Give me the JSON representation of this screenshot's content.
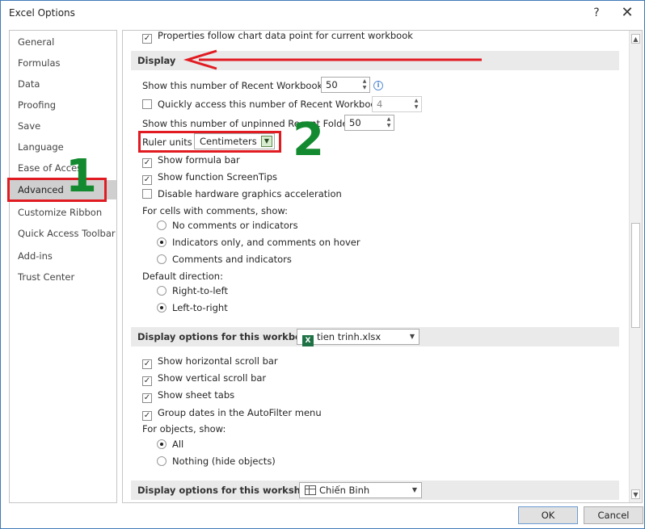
{
  "window": {
    "title": "Excel Options",
    "help": "?",
    "close": "✕"
  },
  "nav": {
    "items": [
      "General",
      "Formulas",
      "Data",
      "Proofing",
      "Save",
      "Language",
      "Ease of Access",
      "Advanced",
      "Customize Ribbon",
      "Quick Access Toolbar",
      "Add-ins",
      "Trust Center"
    ],
    "active": "Advanced"
  },
  "content": {
    "top_option": "Properties follow chart data point for current workbook",
    "display": {
      "header": "Display",
      "recent_workbooks_label": "Show this number of Recent Workbooks:",
      "recent_workbooks_value": "50",
      "quick_access_label": "Quickly access this number of Recent Workbooks:",
      "quick_access_value": "4",
      "unpinned_label": "Show this number of unpinned Recent Folders:",
      "unpinned_value": "50",
      "ruler_units_label": "Ruler units",
      "ruler_units_value": "Centimeters",
      "show_formula_bar": "Show formula bar",
      "show_function_screentips": "Show function ScreenTips",
      "disable_hw_accel": "Disable hardware graphics acceleration",
      "comments_label": "For cells with comments, show:",
      "comments_none": "No comments or indicators",
      "comments_indicators": "Indicators only, and comments on hover",
      "comments_all": "Comments and indicators",
      "direction_label": "Default direction:",
      "direction_rtl": "Right-to-left",
      "direction_ltr": "Left-to-right"
    },
    "workbook": {
      "header": "Display options for this workbook:",
      "selected": "tien trinh.xlsx",
      "h_scroll": "Show horizontal scroll bar",
      "v_scroll": "Show vertical scroll bar",
      "sheet_tabs": "Show sheet tabs",
      "group_dates": "Group dates in the AutoFilter menu",
      "objects_label": "For objects, show:",
      "objects_all": "All",
      "objects_nothing": "Nothing (hide objects)"
    },
    "worksheet": {
      "header": "Display options for this worksheet:",
      "selected": "Chiến Binh"
    }
  },
  "annotations": {
    "step1": "1",
    "step2": "2"
  },
  "buttons": {
    "ok": "OK",
    "cancel": "Cancel"
  },
  "colors": {
    "highlight": "#e11b22",
    "step_number": "#138a2f",
    "active_nav": "#cfcfcf"
  }
}
